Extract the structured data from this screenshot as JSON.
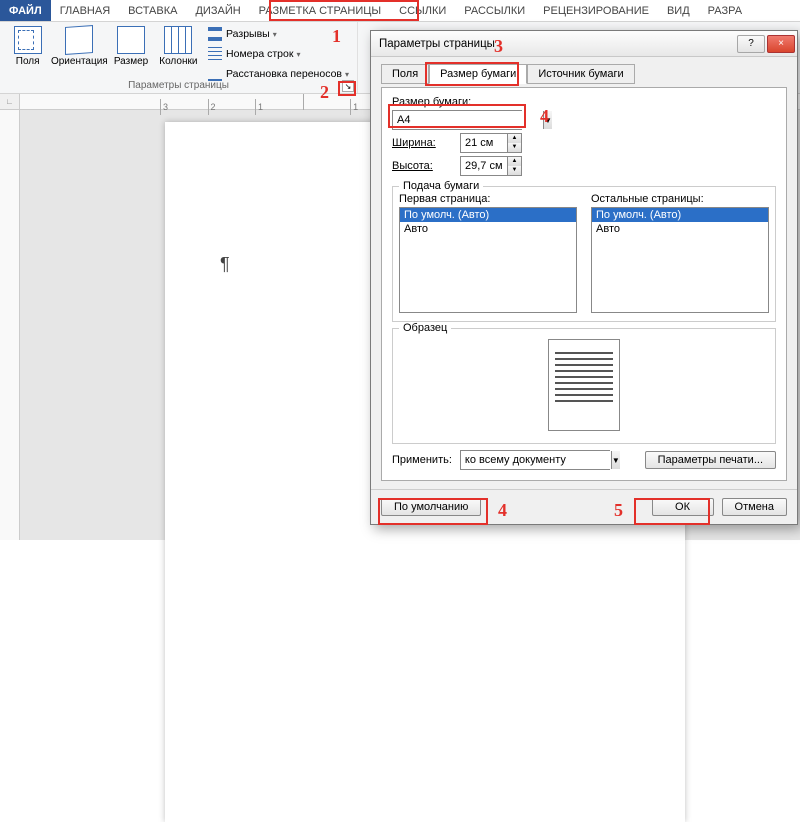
{
  "tabs": {
    "file": "ФАЙЛ",
    "home": "ГЛАВНАЯ",
    "insert": "ВСТАВКА",
    "design": "ДИЗАЙН",
    "layout": "РАЗМЕТКА СТРАНИЦЫ",
    "references": "ССЫЛКИ",
    "mailings": "РАССЫЛКИ",
    "review": "РЕЦЕНЗИРОВАНИЕ",
    "view": "ВИД",
    "dev": "РАЗРА"
  },
  "ribbon": {
    "fields": "Поля",
    "orientation": "Ориентация",
    "size": "Размер",
    "columns": "Колонки",
    "breaks": "Разрывы",
    "line_numbers": "Номера строк",
    "hyphenation": "Расстановка переносов",
    "group_label": "Параметры страницы"
  },
  "ruler": {
    "marks": [
      "3",
      "2",
      "1",
      "",
      "1"
    ]
  },
  "callouts": {
    "n1": "1",
    "n2": "2",
    "n3": "3",
    "n4": "4",
    "n4b": "4",
    "n5": "5"
  },
  "dialog": {
    "title": "Параметры страницы",
    "help": "?",
    "close": "×",
    "tab_fields": "Поля",
    "tab_paper": "Размер бумаги",
    "tab_source": "Источник бумаги",
    "paper_legend": "Размер бумаги:",
    "paper_value": "A4",
    "width_label": "Ширина:",
    "width_value": "21 см",
    "height_label": "Высота:",
    "height_value": "29,7 см",
    "feed_legend": "Подача бумаги",
    "first_label": "Первая страница:",
    "rest_label": "Остальные страницы:",
    "opt_default": "По умолч. (Авто)",
    "opt_auto": "Авто",
    "sample_legend": "Образец",
    "apply_label": "Применить:",
    "apply_value": "ко всему документу",
    "print_options": "Параметры печати...",
    "btn_default": "По умолчанию",
    "btn_ok": "ОК",
    "btn_cancel": "Отмена"
  },
  "doc": {
    "pilcrow": "¶",
    "ruler_corner": "∟"
  }
}
